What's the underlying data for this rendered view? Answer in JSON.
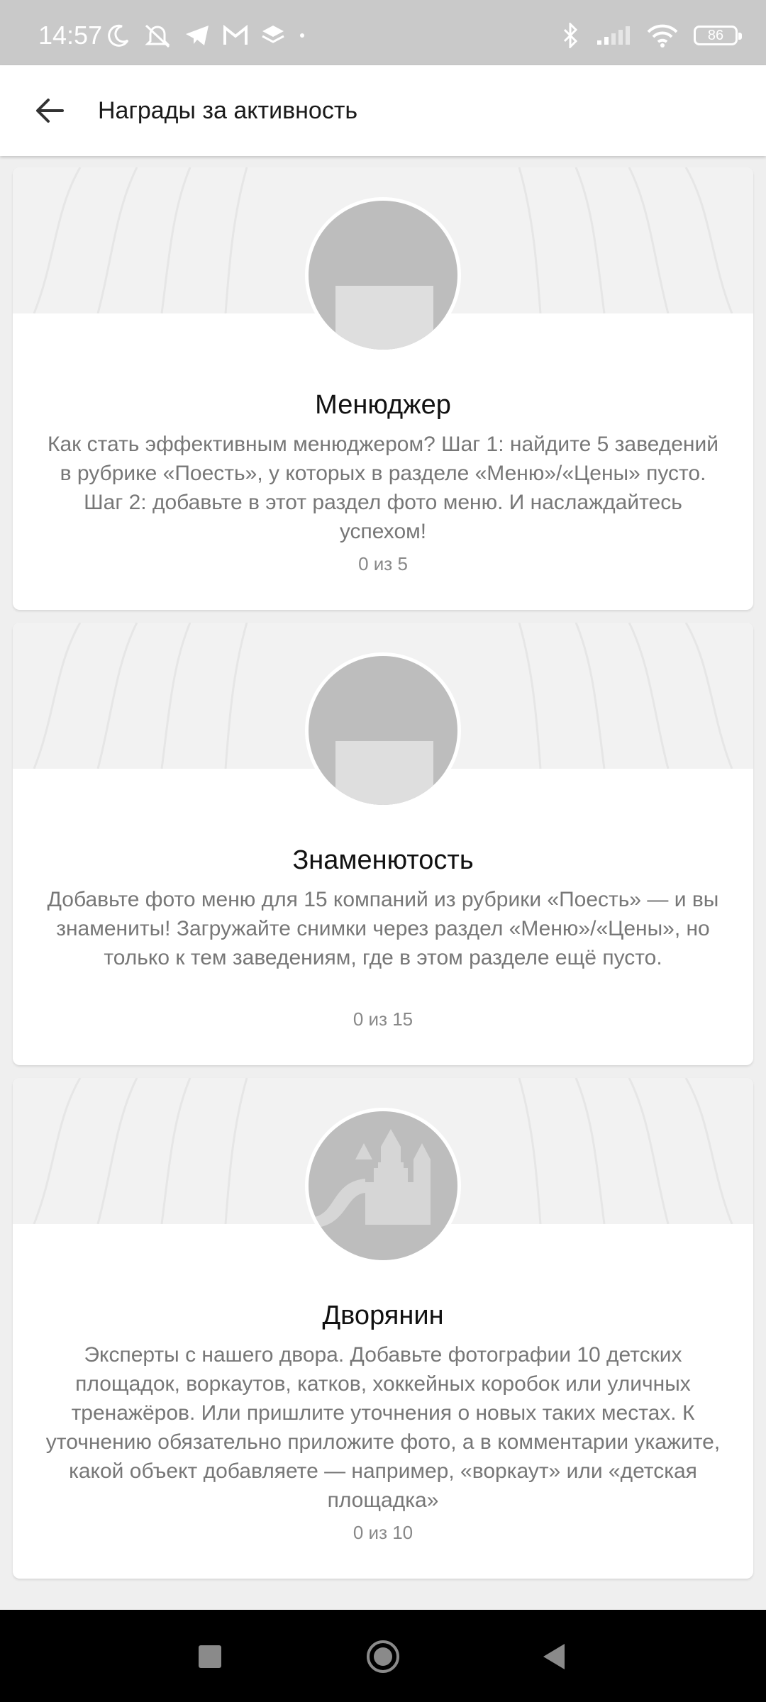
{
  "status_bar": {
    "time": "14:57",
    "left_icons": [
      "moon-icon",
      "bell-off-icon",
      "telegram-icon",
      "gmail-icon",
      "layers-icon",
      "dot-icon"
    ],
    "right_icons": [
      "bluetooth-icon",
      "signal-icon",
      "wifi-icon"
    ],
    "battery": "86"
  },
  "header": {
    "back_icon": "arrow-left-icon",
    "title": "Награды за активность"
  },
  "cards": [
    {
      "title": "Менюджер",
      "description": "Как стать эффективным менюджером? Шаг 1: найдите 5 заведений в рубрике «Поесть», у которых в разделе «Меню»/«Цены» пусто. Шаг 2: добавьте в этот раздел фото меню. И наслаждайтесь успехом!",
      "progress": "0 из 5",
      "progress_value": 0,
      "progress_total": 5,
      "icon": "menu-badge-icon"
    },
    {
      "title": "Знаменютость",
      "description": "Добавьте фото меню для 15 компаний из рубрики «Поесть» — и вы знамениты! Загружайте снимки через раздел «Меню»/«Цены», но только к тем заведениям, где в этом разделе ещё пусто.",
      "progress": "0 из 15",
      "progress_value": 0,
      "progress_total": 15,
      "icon": "menu-badge-icon"
    },
    {
      "title": "Дворянин",
      "description": "Эксперты с нашего двора. Добавьте фотографии 10 детских площадок, воркаутов, катков, хоккейных коробок или уличных тренажёров. Или пришлите уточнения о новых таких местах. К уточнению обязательно приложите фото, а в комментарии укажите, какой объект добавляете — например, «воркаут» или «детская площадка»",
      "progress": "0 из 10",
      "progress_value": 0,
      "progress_total": 10,
      "icon": "castle-badge-icon"
    }
  ],
  "nav_bar": {
    "buttons": [
      "recents-square-icon",
      "home-circle-icon",
      "back-triangle-icon"
    ]
  },
  "colors": {
    "status_bar_bg": "#c9c9c9",
    "page_bg": "#efefef",
    "badge_gray": "#bdbdbd",
    "text_secondary": "#777777"
  }
}
